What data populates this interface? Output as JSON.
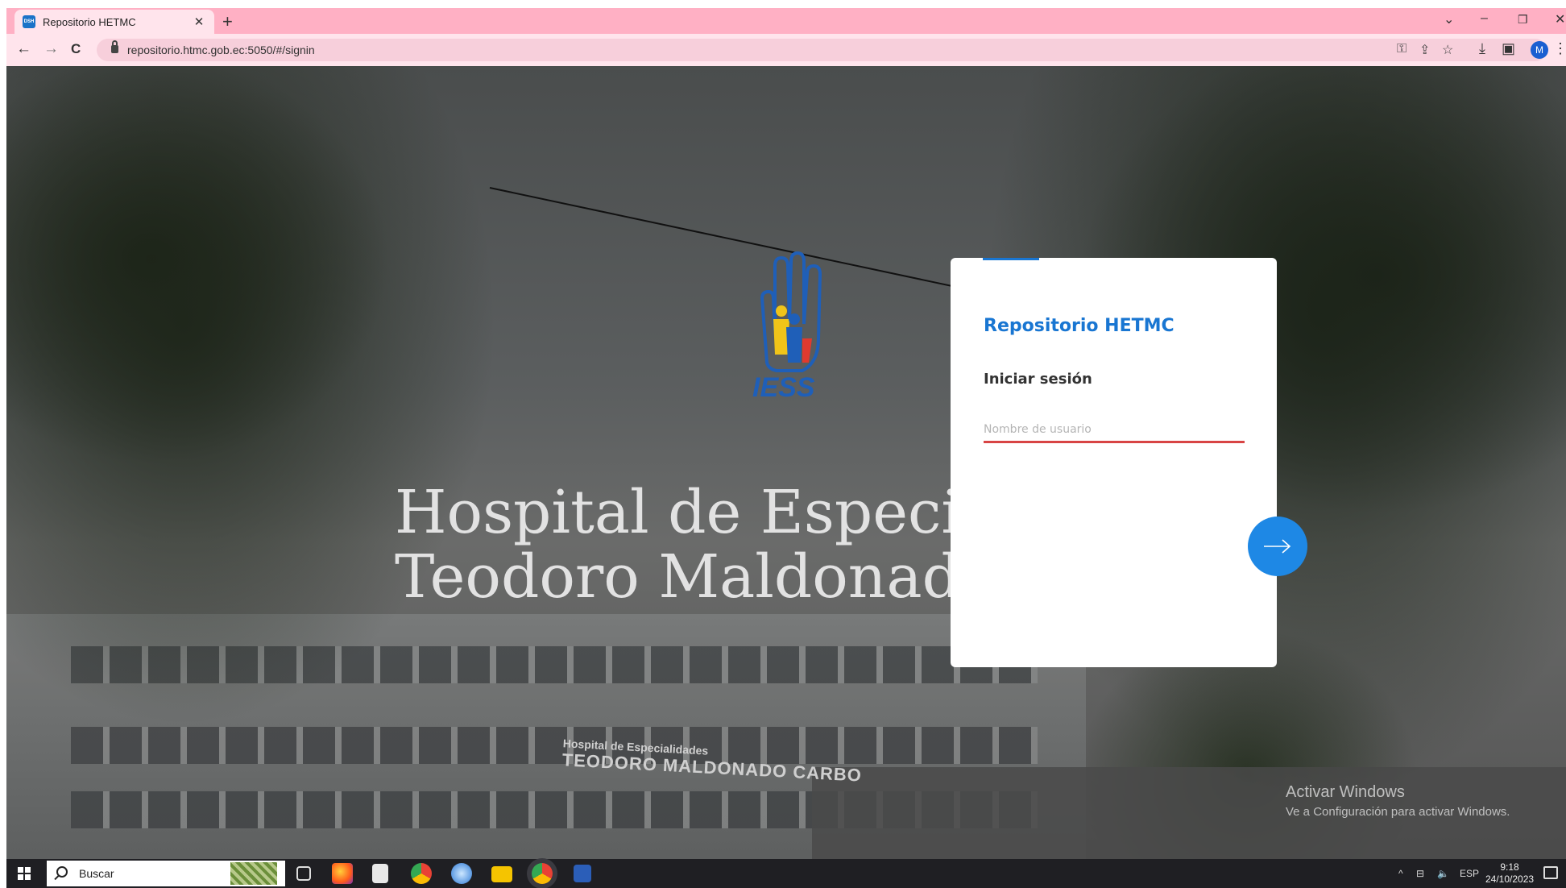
{
  "browser": {
    "tab_title": "Repositorio HETMC",
    "tab_close": "✕",
    "new_tab": "+",
    "url": "repositorio.htmc.gob.ec:5050/#/signin",
    "profile_initial": "M",
    "favicon_text": "DSH",
    "window_controls": {
      "chevron": "⌄",
      "minimize": "–",
      "restore": "❐",
      "close": "✕"
    },
    "nav": {
      "back": "←",
      "forward": "→",
      "reload": "C"
    },
    "toolbar_icons": {
      "key": "⚿",
      "share": "⇪",
      "star": "☆",
      "download": "⤓",
      "sidepanel": "▣",
      "menu": "⋮"
    }
  },
  "page": {
    "hero_line1": "Hospital de Especialidades",
    "hero_line2": "Teodoro Maldonado Carbo",
    "sign_line1": "Hospital de Especialidades",
    "sign_line2": "TEODORO MALDONADO CARBO",
    "logo_text": "IESS"
  },
  "login": {
    "app_title": "Repositorio HETMC",
    "subtitle": "Iniciar sesión",
    "username_placeholder": "Nombre de usuario",
    "username_value": "",
    "accent_color": "#1976d2",
    "error_underline_color": "#d84444",
    "next_button_color": "#1e88e5"
  },
  "watermark": {
    "line1": "Activar Windows",
    "line2": "Ve a Configuración para activar Windows."
  },
  "taskbar": {
    "search_label": "Buscar",
    "apps": [
      "task-view-icon",
      "firefox-icon",
      "calculator-icon",
      "chrome-icon",
      "browser-icon",
      "file-explorer-icon",
      "chrome-profile-icon",
      "word-icon"
    ],
    "tray_chevron": "^",
    "tray_network": "⊟",
    "tray_volume": "🔈",
    "language": "ESP",
    "time": "9:18",
    "date": "24/10/2023"
  }
}
